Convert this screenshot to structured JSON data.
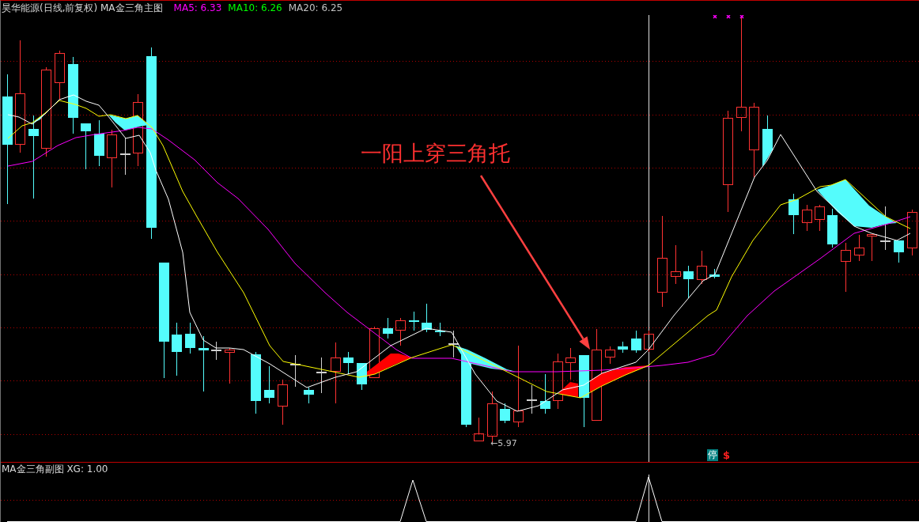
{
  "main_chart": {
    "title": "昊华能源(日线,前复权) MA金三角主图",
    "indicators": [
      {
        "label": "MA5: 6.33",
        "color": "#ff00ff"
      },
      {
        "label": "MA10: 6.26",
        "color": "#00ff00"
      },
      {
        "label": "MA20: 6.25",
        "color": "#c0c0c0"
      }
    ],
    "annotation": "一阳上穿三角托",
    "low_label": "←5.97",
    "badges": [
      {
        "kind": "stop",
        "text": "停"
      },
      {
        "kind": "signal",
        "text": "$"
      }
    ]
  },
  "sub_chart": {
    "title": "MA金三角副图 XG: 1.00"
  }
}
